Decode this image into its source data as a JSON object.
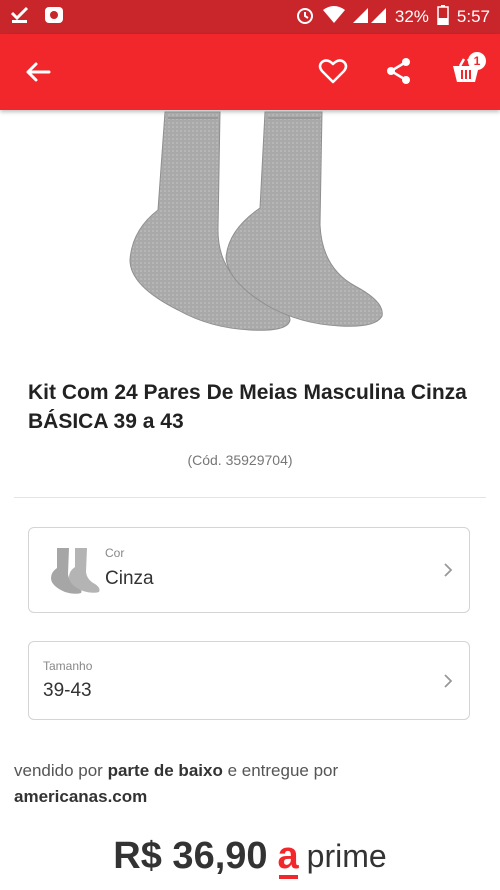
{
  "status_bar": {
    "battery": "32%",
    "time": "5:57",
    "icons": [
      "download-done-icon",
      "notification-icon",
      "alarm-icon",
      "wifi-icon",
      "signal-icon",
      "battery-icon"
    ]
  },
  "app_bar": {
    "icons": [
      "back-arrow-icon",
      "heart-icon",
      "share-icon",
      "cart-icon"
    ],
    "cart_count": "1",
    "accent_color": "#f2272c"
  },
  "product": {
    "title": "Kit Com 24 Pares De Meias Masculina Cinza BÁSICA 39 a 43",
    "code": "(Cód. 35929704)"
  },
  "options": {
    "color": {
      "label": "Cor",
      "value": "Cinza"
    },
    "size": {
      "label": "Tamanho",
      "value": "39-43"
    }
  },
  "seller": {
    "prefix": "vendido por",
    "seller_name": "parte de baixo",
    "middle": "e entregue por",
    "deliverer": "americanas.com"
  },
  "price": {
    "value": "R$ 36,90",
    "badge_text": "prime",
    "badge_letter": "a"
  }
}
